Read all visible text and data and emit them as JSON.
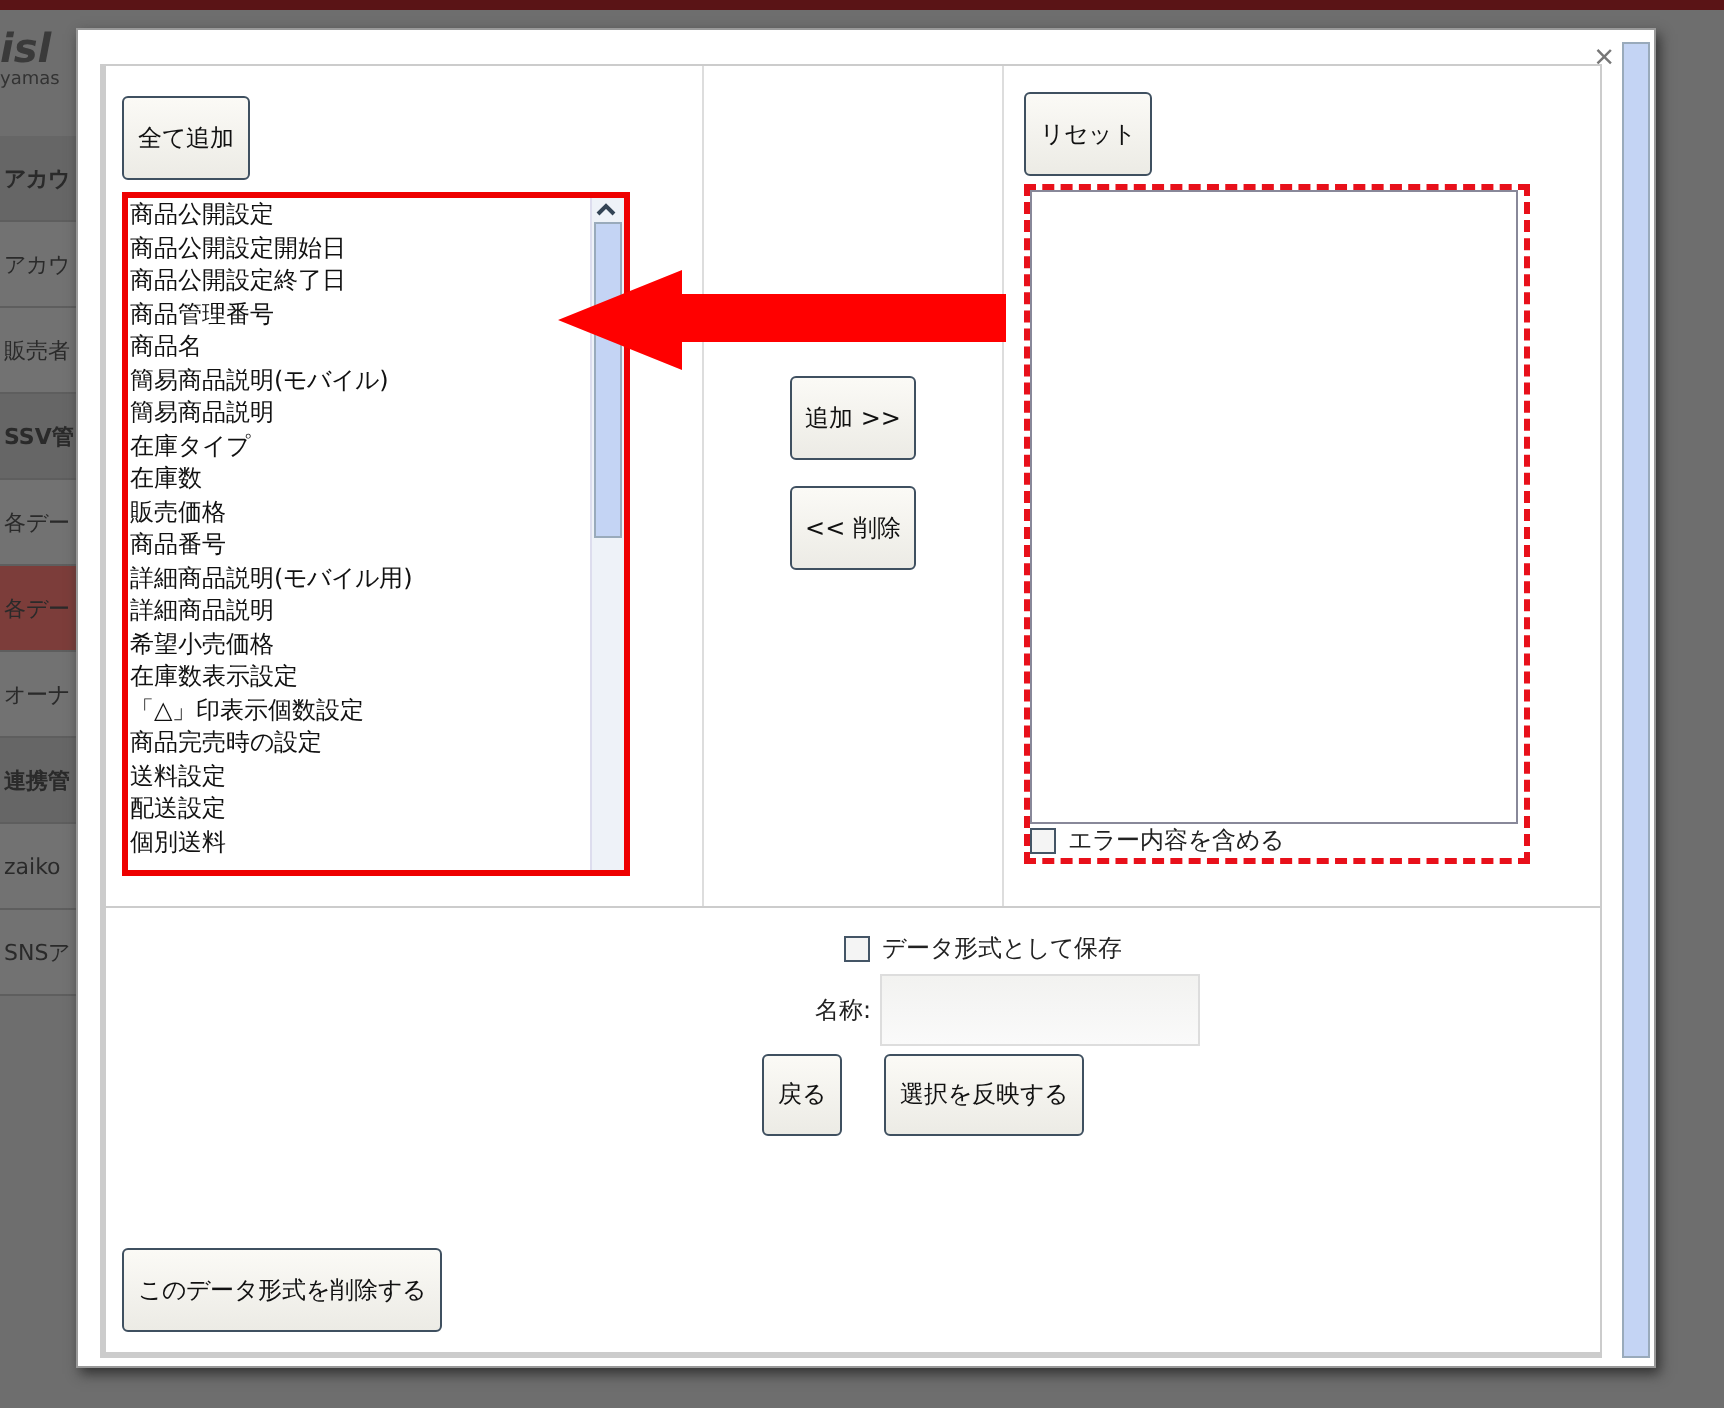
{
  "background_page": {
    "logo": "isl",
    "user": "yamas",
    "sidebar": [
      {
        "label": "アカウ",
        "kind": "header",
        "selected": false
      },
      {
        "label": "アカウ",
        "kind": "item",
        "selected": false
      },
      {
        "label": "販売者",
        "kind": "item",
        "selected": false
      },
      {
        "label": "SSV管",
        "kind": "header",
        "selected": false
      },
      {
        "label": "各デー",
        "kind": "item",
        "selected": false
      },
      {
        "label": "各デー",
        "kind": "item",
        "selected": true
      },
      {
        "label": "オーナ",
        "kind": "item",
        "selected": false
      },
      {
        "label": "連携管",
        "kind": "header",
        "selected": false
      },
      {
        "label": "zaiko",
        "kind": "item",
        "selected": false
      },
      {
        "label": "SNSア",
        "kind": "item",
        "selected": false
      }
    ]
  },
  "dialog": {
    "close": "×",
    "add_all_button": "全て追加",
    "available_fields": [
      "商品公開設定",
      "商品公開設定開始日",
      "商品公開設定終了日",
      "商品管理番号",
      "商品名",
      "簡易商品説明(モバイル)",
      "簡易商品説明",
      "在庫タイプ",
      "在庫数",
      "販売価格",
      "商品番号",
      "詳細商品説明(モバイル用)",
      "詳細商品説明",
      "希望小売価格",
      "在庫数表示設定",
      "「△」印表示個数設定",
      "商品完売時の設定",
      "送料設定",
      "配送設定",
      "個別送料"
    ],
    "add_button": "追加 >>",
    "remove_button": "<< 削除",
    "reset_button": "リセット",
    "include_errors": {
      "label": "エラー内容を含める",
      "checked": false
    },
    "save_as_format": {
      "label": "データ形式として保存",
      "checked": false
    },
    "name_field": {
      "label": "名称:"
    },
    "back_button": "戻る",
    "apply_button": "選択を反映する",
    "delete_format_button": "このデータ形式を削除する"
  }
}
